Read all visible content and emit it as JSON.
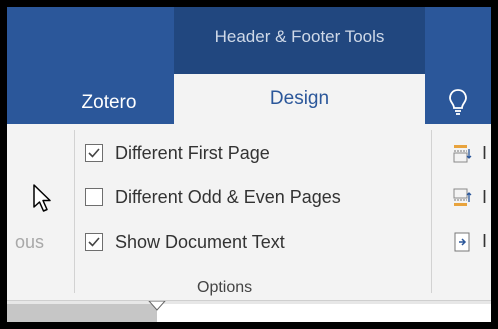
{
  "ribbon": {
    "contextual_title": "Header & Footer Tools",
    "tabs": [
      {
        "label": "Zotero",
        "selected": false
      },
      {
        "label": "Design",
        "selected": true
      }
    ]
  },
  "left_group": {
    "truncated_label": "ous"
  },
  "options_group": {
    "items": [
      {
        "label": "Different First Page",
        "checked": true
      },
      {
        "label": "Different Odd & Even Pages",
        "checked": false
      },
      {
        "label": "Show Document Text",
        "checked": true
      }
    ],
    "group_label": "Options"
  },
  "position_group": {
    "partial_labels": [
      "I",
      "I",
      "I"
    ]
  },
  "colors": {
    "ribbon_blue": "#2b579a",
    "contextual_blue": "#21477f",
    "ribbon_body": "#f3f3f3"
  },
  "icons": [
    "lightbulb-icon",
    "cursor-icon",
    "checkmark-icon",
    "header-from-top-icon",
    "footer-from-bottom-icon",
    "insert-alignment-tab-icon"
  ]
}
